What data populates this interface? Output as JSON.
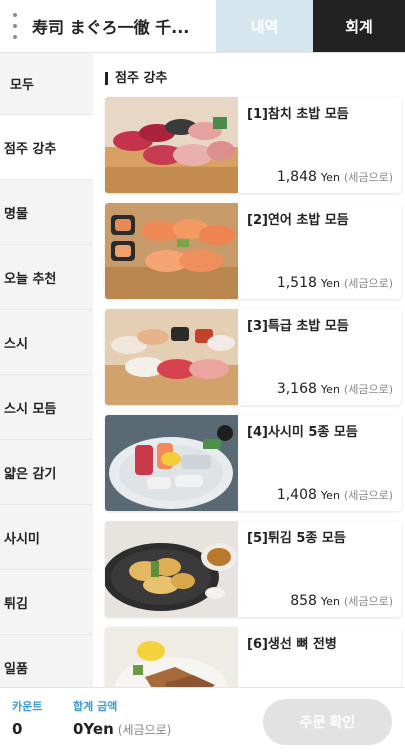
{
  "header": {
    "title": "寿司 まぐろ一徹 千...",
    "tab_history": "내역",
    "tab_bill": "회계"
  },
  "sidebar": {
    "items": [
      {
        "label": "모두"
      },
      {
        "label": "점주 강추"
      },
      {
        "label": "명물"
      },
      {
        "label": "오늘 추천"
      },
      {
        "label": "스시"
      },
      {
        "label": "스시 모듬"
      },
      {
        "label": "얇은 감기"
      },
      {
        "label": "사시미"
      },
      {
        "label": "튀김"
      },
      {
        "label": "일품"
      }
    ]
  },
  "main": {
    "section_title": "점주 강추",
    "items": [
      {
        "name": "[1]참치 초밥 모듬",
        "price": "1,848",
        "unit": "Yen",
        "tax": "(세금으로)"
      },
      {
        "name": "[2]연어 초밥 모듬",
        "price": "1,518",
        "unit": "Yen",
        "tax": "(세금으로)"
      },
      {
        "name": "[3]특급 초밥 모듬",
        "price": "3,168",
        "unit": "Yen",
        "tax": "(세금으로)"
      },
      {
        "name": "[4]사시미 5종 모듬",
        "price": "1,408",
        "unit": "Yen",
        "tax": "(세금으로)"
      },
      {
        "name": "[5]튀김 5종 모듬",
        "price": "858",
        "unit": "Yen",
        "tax": "(세금으로)"
      },
      {
        "name": "[6]생선 뼈 전병",
        "price": "",
        "unit": "",
        "tax": ""
      }
    ]
  },
  "footer": {
    "count_label": "카운트",
    "count_value": "0",
    "total_label": "합계 금액",
    "total_value": "0Yen",
    "total_tax": "(세금으로)",
    "order_button": "주문 확인"
  },
  "colors": {
    "accent_blue": "#3a9bd5",
    "tab_history_bg": "#d6e6ee",
    "tab_bill_bg": "#222222",
    "order_button_bg": "#e2e2e2"
  }
}
